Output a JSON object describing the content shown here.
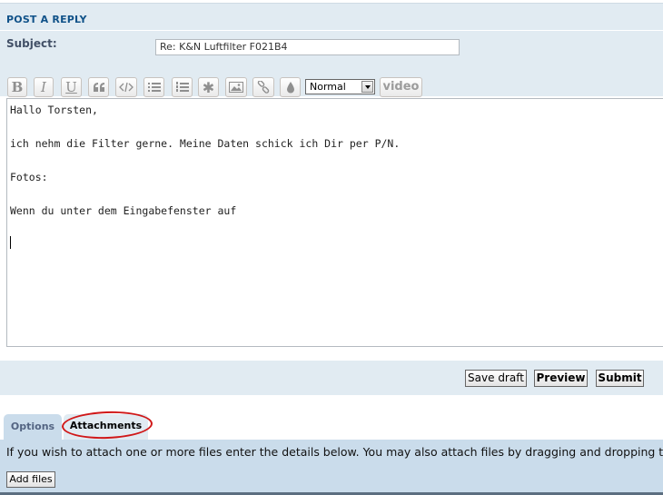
{
  "post_reply": {
    "title": "POST A REPLY",
    "subject_label": "Subject:",
    "subject_value": "Re: K&N Luftfilter F021B4"
  },
  "toolbar": {
    "font_size_selected": "Normal",
    "video_label": "video",
    "icons": [
      "bold-icon",
      "italic-icon",
      "underline-icon",
      "quote-icon",
      "code-icon",
      "list-icon",
      "numbered-list-icon",
      "star-icon",
      "image-icon",
      "link-icon",
      "color-drop-icon"
    ]
  },
  "editor": {
    "lines": [
      "Hallo Torsten,",
      "",
      "ich nehm die Filter gerne. Meine Daten schick ich Dir per P/N.",
      "",
      "Fotos:",
      "",
      "Wenn du unter dem Eingabefenster auf"
    ]
  },
  "actions": {
    "save_draft": "Save draft",
    "preview": "Preview",
    "submit": "Submit"
  },
  "tabs": {
    "options": "Options",
    "attachments": "Attachments"
  },
  "attachments": {
    "info_text": "If you wish to attach one or more files enter the details below. You may also attach files by dragging and dropping them",
    "add_files": "Add files"
  },
  "colors": {
    "panel": "#e1ebf2",
    "panel_dark": "#cadceb",
    "title": "#105289",
    "annotation": "#d01818"
  }
}
